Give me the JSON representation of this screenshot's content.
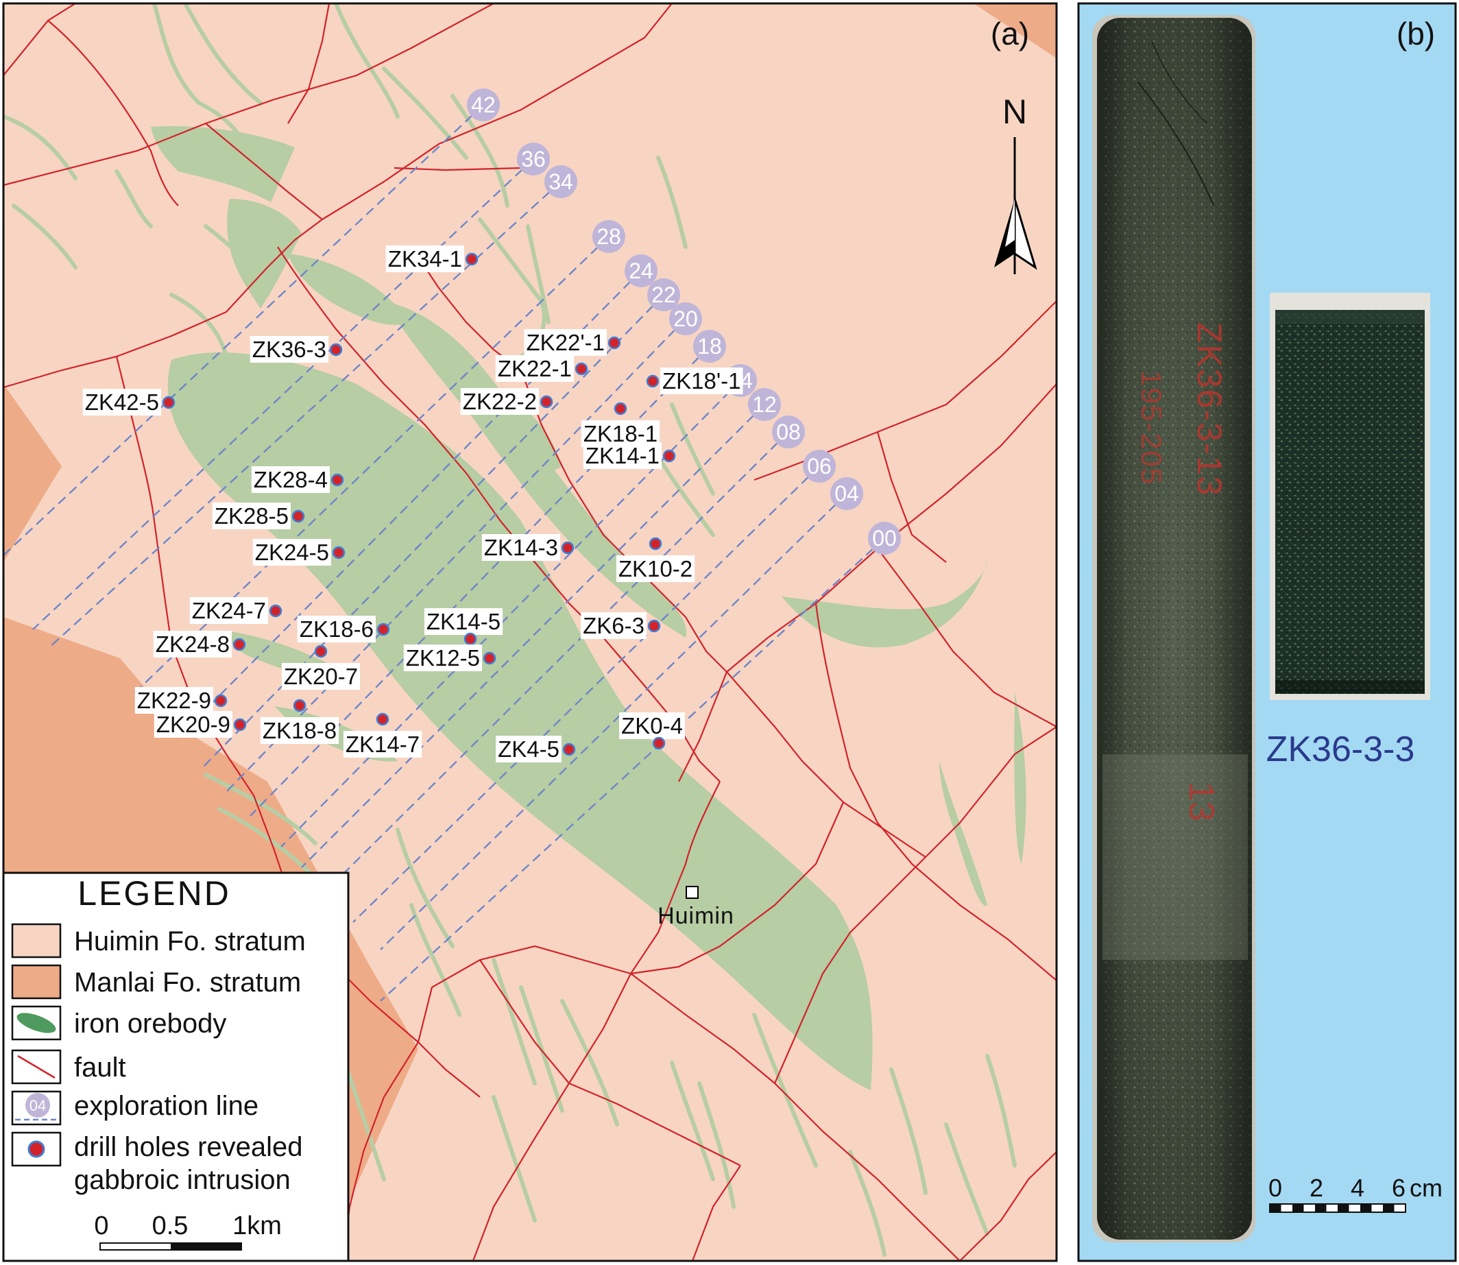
{
  "panel_a": {
    "label": "(a)",
    "north": "N",
    "town": "Huimin",
    "colors": {
      "huimin_stratum": "#f8d5c3",
      "manlai_stratum": "#eeab88",
      "orebody": "#b7cda4",
      "fault": "#d2232a",
      "exploration_line": "#6f86c8",
      "line_badge": "#bfb5d8",
      "drill_hole": "#d2232a"
    },
    "exploration_lines": [
      "42",
      "36",
      "34",
      "28",
      "24",
      "22",
      "20",
      "18",
      "14",
      "12",
      "08",
      "06",
      "04",
      "00"
    ],
    "drill_holes": [
      "ZK34-1",
      "ZK36-3",
      "ZK42-5",
      "ZK22'-1",
      "ZK22-1",
      "ZK22-2",
      "ZK18'-1",
      "ZK18-1",
      "ZK14-1",
      "ZK28-4",
      "ZK28-5",
      "ZK24-5",
      "ZK14-3",
      "ZK10-2",
      "ZK24-7",
      "ZK18-6",
      "ZK14-5",
      "ZK24-8",
      "ZK20-7",
      "ZK12-5",
      "ZK6-3",
      "ZK22-9",
      "ZK20-9",
      "ZK18-8",
      "ZK14-7",
      "ZK0-4",
      "ZK4-5"
    ],
    "legend": {
      "title": "LEGEND",
      "items": [
        {
          "key": "huimin",
          "label": "Huimin Fo. stratum"
        },
        {
          "key": "manlai",
          "label": "Manlai Fo. stratum"
        },
        {
          "key": "orebody",
          "label": "iron orebody"
        },
        {
          "key": "fault",
          "label": "fault"
        },
        {
          "key": "exploration",
          "label": "exploration line",
          "sample": "04"
        },
        {
          "key": "drill",
          "label": "drill holes revealed",
          "label2": "gabbroic intrusion"
        }
      ]
    },
    "scale": {
      "ticks": [
        "0",
        "0.5",
        "1km"
      ]
    }
  },
  "panel_b": {
    "label": "(b)",
    "sample_label": "ZK36-3-3",
    "core_marks": [
      "ZK36-3-13",
      "195-205",
      "13"
    ],
    "scale": {
      "ticks": [
        "0",
        "2",
        "4",
        "6"
      ],
      "unit": "cm"
    },
    "colors": {
      "background": "#a4d9f4",
      "sample_text": "#2a3a8c",
      "core": "#3f463a"
    }
  }
}
